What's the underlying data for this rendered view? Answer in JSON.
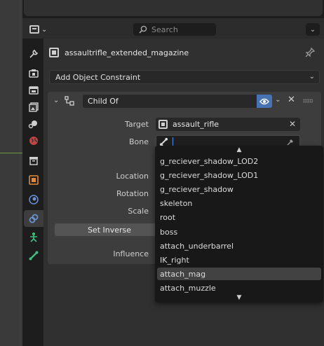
{
  "search": {
    "placeholder": "Search"
  },
  "object": {
    "name": "assaultrifle_extended_magazine"
  },
  "add_constraint": {
    "label": "Add Object Constraint"
  },
  "constraint": {
    "name": "Child Of",
    "target_label": "Target",
    "target_value": "assault_rifle",
    "bone_label": "Bone",
    "bone_value": "",
    "location_label": "Location",
    "rotation_label": "Rotation",
    "scale_label": "Scale",
    "set_inverse_label": "Set Inverse",
    "influence_label": "Influence"
  },
  "bone_dropdown": {
    "items": [
      "g_reciever_shadow_LOD2",
      "g_reciever_shadow_LOD1",
      "g_reciever_shadow",
      "skeleton",
      "root",
      "boss",
      "attach_underbarrel",
      "IK_right",
      "attach_mag",
      "attach_muzzle"
    ],
    "highlighted_index": 8
  },
  "colors": {
    "accent": "#4772b3",
    "highlight": "#424242"
  },
  "icons": {
    "tabs": [
      "tool-icon",
      "render-icon",
      "output-icon",
      "view-layer-icon",
      "scene-icon",
      "world-icon",
      "collection-icon",
      "object-icon",
      "modifier-icon",
      "constraint-icon",
      "physics-icon",
      "bone-icon"
    ]
  }
}
